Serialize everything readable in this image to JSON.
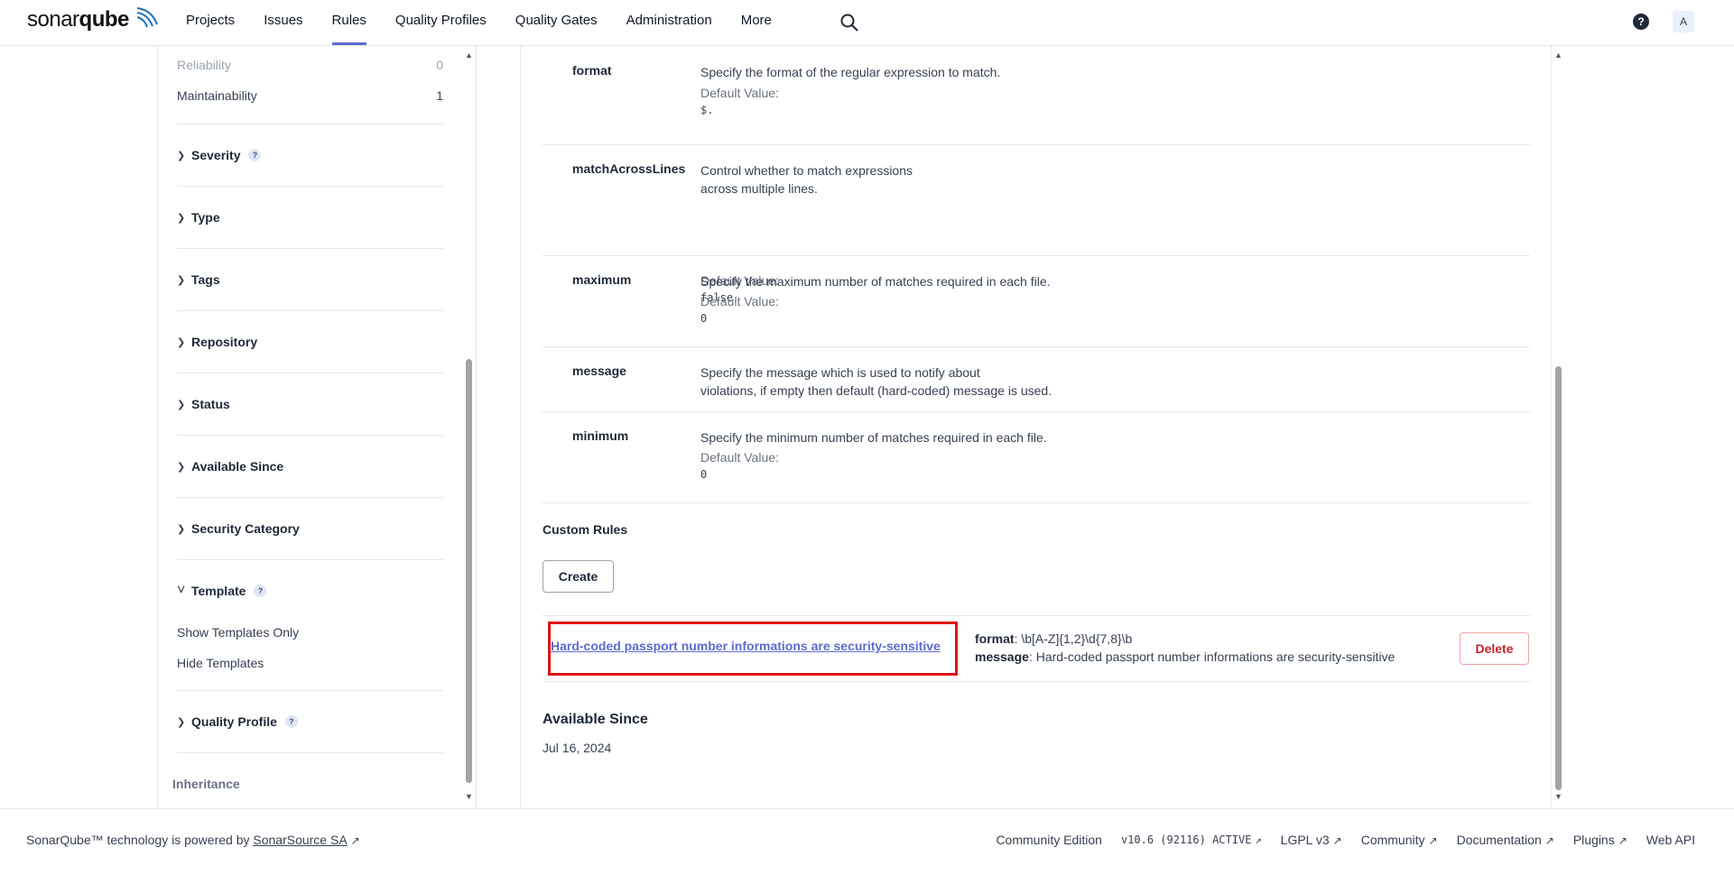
{
  "brand": {
    "light": "sonar",
    "bold": "qube"
  },
  "nav": {
    "items": [
      {
        "label": "Projects",
        "active": false
      },
      {
        "label": "Issues",
        "active": false
      },
      {
        "label": "Rules",
        "active": true
      },
      {
        "label": "Quality Profiles",
        "active": false
      },
      {
        "label": "Quality Gates",
        "active": false
      },
      {
        "label": "Administration",
        "active": false
      },
      {
        "label": "More",
        "active": false
      }
    ],
    "help_glyph": "?",
    "avatar_letter": "A"
  },
  "sidebar": {
    "impact_rows": [
      {
        "label": "Reliability",
        "count": "0"
      },
      {
        "label": "Maintainability",
        "count": "1"
      }
    ],
    "facets": [
      {
        "label": "Severity",
        "help": true,
        "expanded": false
      },
      {
        "label": "Type",
        "help": false,
        "expanded": false
      },
      {
        "label": "Tags",
        "help": false,
        "expanded": false
      },
      {
        "label": "Repository",
        "help": false,
        "expanded": false
      },
      {
        "label": "Status",
        "help": false,
        "expanded": false
      },
      {
        "label": "Available Since",
        "help": false,
        "expanded": false
      },
      {
        "label": "Security Category",
        "help": false,
        "expanded": false
      },
      {
        "label": "Template",
        "help": true,
        "expanded": true
      }
    ],
    "template_options": [
      "Show Templates Only",
      "Hide Templates"
    ],
    "quality_profile": {
      "label": "Quality Profile",
      "help": true
    },
    "inheritance_label": "Inheritance"
  },
  "params": [
    {
      "key": "format",
      "desc": [
        "Specify the format of the regular expression to match."
      ],
      "default_label": "Default Value:",
      "default": "$."
    },
    {
      "key": "matchAcrossLines",
      "desc": [
        "Control whether to match expressions",
        "across multiple lines."
      ],
      "default_label": "Default Value:",
      "default": "false"
    },
    {
      "key": "maximum",
      "desc": [
        "Specify the maximum number of matches required in each file."
      ],
      "default_label": "Default Value:",
      "default": "0"
    },
    {
      "key": "message",
      "desc": [
        "Specify the message which is used to notify about",
        "violations, if empty then default (hard-coded) message is used."
      ],
      "default_label": "",
      "default": ""
    },
    {
      "key": "minimum",
      "desc": [
        "Specify the minimum number of matches required in each file."
      ],
      "default_label": "Default Value:",
      "default": "0"
    }
  ],
  "custom_rules": {
    "title": "Custom Rules",
    "create_label": "Create",
    "rule": {
      "name": "Hard-coded passport number informations are security-sensitive",
      "format_key": "format",
      "format_value": ": \\b[A-Z]{1,2}\\d{7,8}\\b",
      "message_key": "message",
      "message_value": ": Hard-coded passport number informations are security-sensitive",
      "delete_label": "Delete"
    }
  },
  "available_since": {
    "title": "Available Since",
    "date": "Jul 16, 2024"
  },
  "footer": {
    "left_prefix": "SonarQube™ technology is powered by ",
    "left_link": "SonarSource SA",
    "edition": "Community Edition",
    "version": "v10.6 (92116) ACTIVE",
    "license": "LGPL v3",
    "community": "Community",
    "documentation": "Documentation",
    "plugins": "Plugins",
    "web_api": "Web API"
  },
  "colors": {
    "accent": "#5d6cd0",
    "highlight": "#e21313",
    "danger": "#c6202b"
  }
}
